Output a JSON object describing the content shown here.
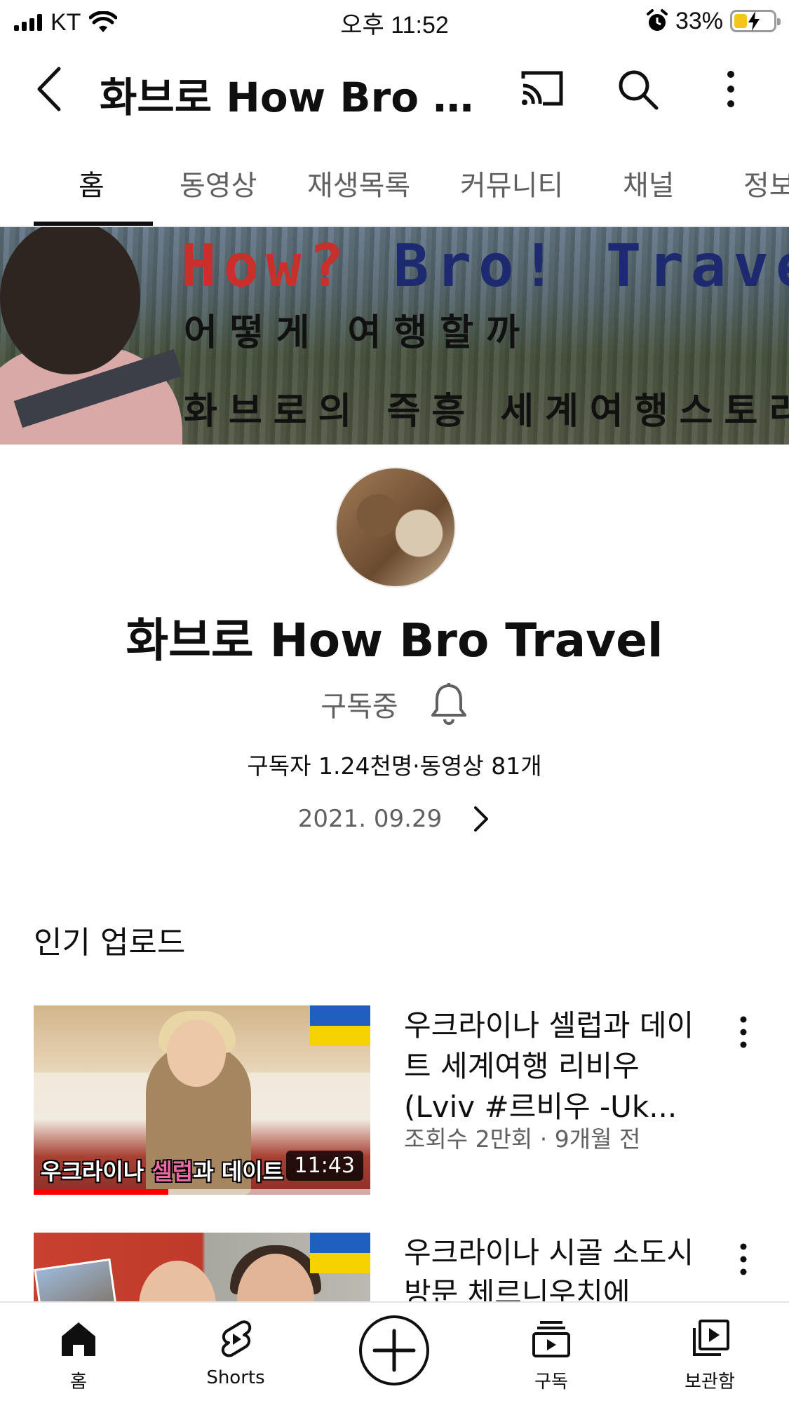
{
  "status_bar": {
    "carrier": "KT",
    "time": "오후 11:52",
    "battery_percent": "33%",
    "battery_level": 0.33
  },
  "app_bar": {
    "title": "화브로 How Bro Travel",
    "icons": [
      "back-arrow-icon",
      "cast-icon",
      "search-icon",
      "more-vertical-icon"
    ]
  },
  "tabs": [
    {
      "label": "홈",
      "active": true
    },
    {
      "label": "동영상"
    },
    {
      "label": "재생목록"
    },
    {
      "label": "커뮤니티"
    },
    {
      "label": "채널"
    },
    {
      "label": "정보"
    }
  ],
  "banner": {
    "line1_red": "How?",
    "line1_blue": "Bro! Travel",
    "line2": "어떻게 여행할까",
    "line3": "화브로의 즉흥 세계여행스토리"
  },
  "channel": {
    "name": "화브로 How Bro Travel",
    "subscribe_state": "구독중",
    "stats": "구독자 1.24천명·동영상 81개",
    "date": "2021. 09.29"
  },
  "section": {
    "title": "인기 업로드"
  },
  "videos": [
    {
      "title": "우크라이나 셀럽과 데이트 세계여행 리비우 (Lviv #르비우 -Uk...",
      "meta": "조회수 2만회 · 9개월 전",
      "duration": "11:43",
      "caption_part1": "우크라이나 ",
      "caption_pink": "셀럽",
      "caption_part2": "과 데이트",
      "watch_progress": 0.4
    },
    {
      "title": "우크라이나 시골 소도시 방문 체르니우치에",
      "meta": ""
    }
  ],
  "colors": {
    "accent_red": "#ff0000",
    "flag_blue": "#1f5fbf",
    "flag_yellow": "#f6d200",
    "banner_red": "#c9302c",
    "banner_blue": "#1e2a70"
  },
  "bottom_nav": [
    {
      "label": "홈",
      "icon": "home-icon"
    },
    {
      "label": "Shorts",
      "icon": "shorts-icon"
    },
    {
      "label": "",
      "icon": "create-plus-icon"
    },
    {
      "label": "구독",
      "icon": "subscriptions-icon"
    },
    {
      "label": "보관함",
      "icon": "library-icon"
    }
  ]
}
